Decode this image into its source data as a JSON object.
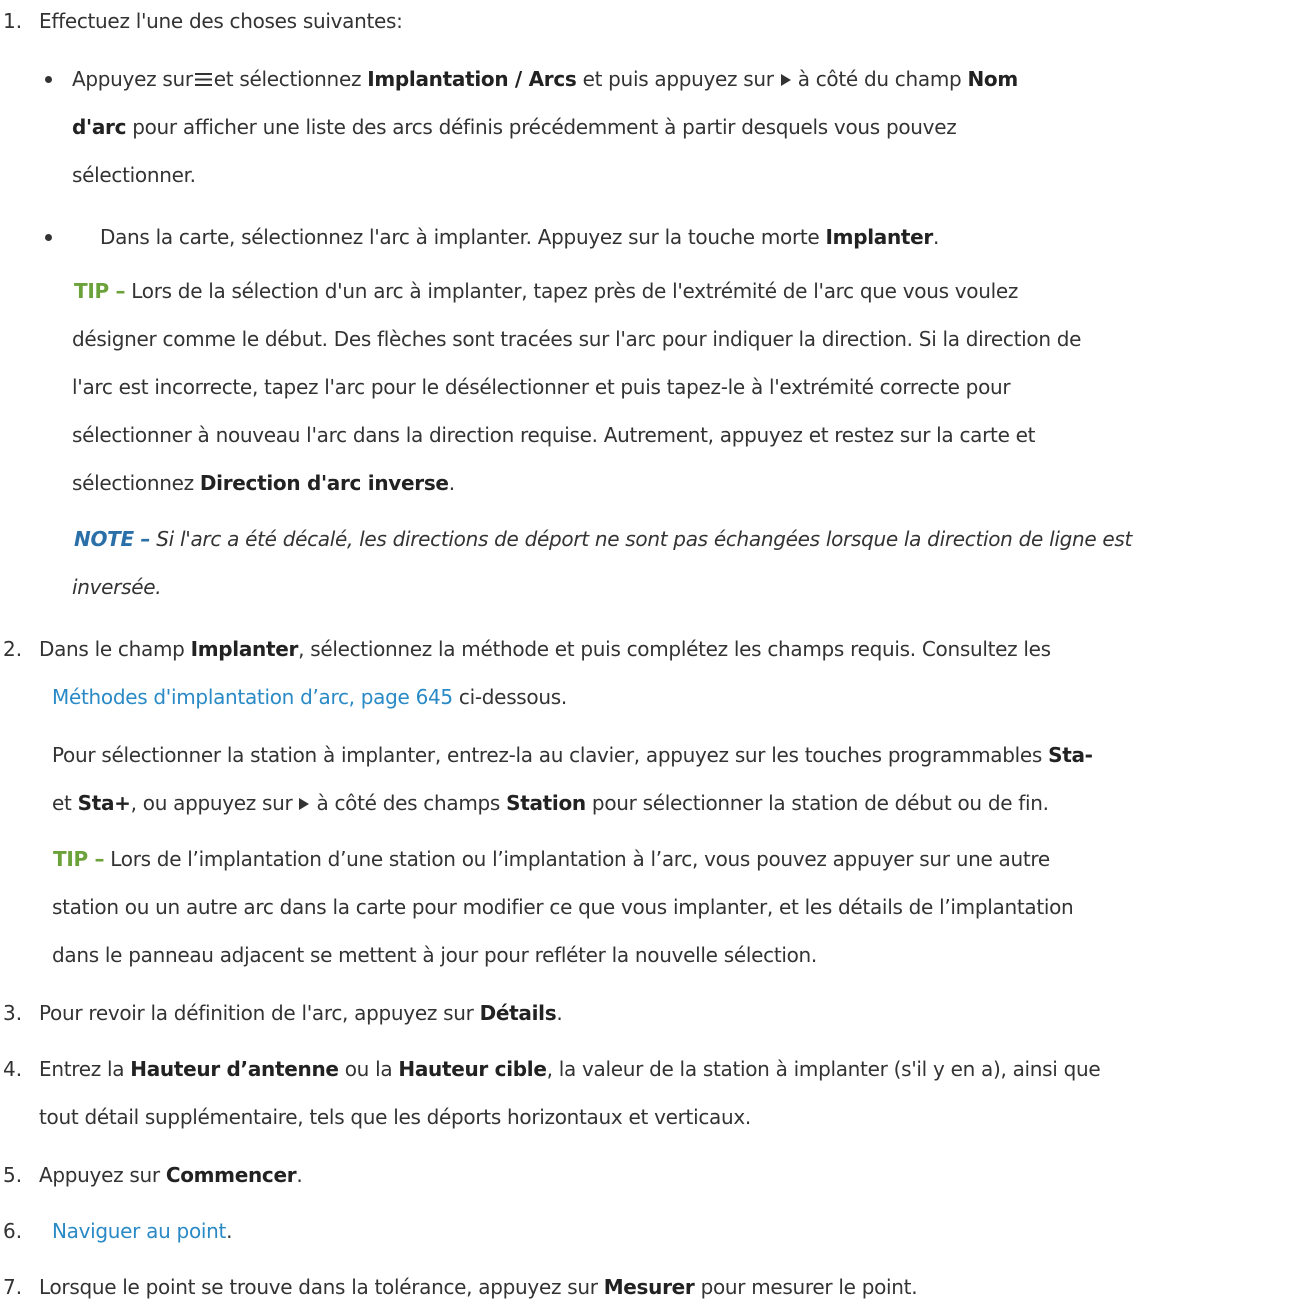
{
  "steps": {
    "s1_num": "1.",
    "s1_text": "Effectuez l'une des choses suivantes:",
    "b1_t1": "Appuyez sur",
    "b1_t2": "et sélectionnez",
    "b1_b1": "Implantation / Arcs",
    "b1_t3": "et puis appuyez sur",
    "b1_t4": "à côté du champ",
    "b1_b2": "Nom",
    "b1_b3": "d'arc",
    "b1_t5": "pour afficher une liste des arcs définis précédemment à partir desquels vous pouvez",
    "b1_t6": "sélectionner.",
    "b2_t1": "Dans la carte, sélectionnez l'arc à implanter. Appuyez sur la touche morte",
    "b2_b1": "Implanter",
    "b2_t2": ".",
    "tip1_label": "TIP –",
    "tip1_l1": "Lors de la sélection d'un arc à implanter, tapez près de l'extrémité de l'arc que vous voulez",
    "tip1_l2": "désigner comme le début. Des flèches sont tracées sur l'arc pour indiquer la direction. Si la direction de",
    "tip1_l3": "l'arc est incorrecte, tapez l'arc pour le désélectionner et puis tapez-le à l'extrémité correcte pour",
    "tip1_l4": "sélectionner à nouveau l'arc dans la direction requise. Autrement, appuyez et restez sur la carte et",
    "tip1_l5a": "sélectionnez",
    "tip1_l5b": "Direction d'arc inverse",
    "tip1_l5c": ".",
    "note_label": "NOTE –",
    "note_l1": "Si l'arc a été décalé, les directions de déport ne sont pas échangées lorsque la direction de ligne est",
    "note_l2": "inversée.",
    "s2_num": "2.",
    "s2_t1": "Dans le champ",
    "s2_b1": "Implanter",
    "s2_t2": ", sélectionnez la méthode et puis complétez les champs requis. Consultez les",
    "s2_link": "Méthodes d'implantation d’arc, page 645",
    "s2_t3": "ci-dessous.",
    "p_l1": "Pour sélectionner la station à implanter, entrez-la au clavier, appuyez sur les touches programmables",
    "p_b1": "Sta-",
    "p_t2": "et",
    "p_b2": "Sta+",
    "p_t3": ", ou appuyez sur",
    "p_t4": "à côté des champs",
    "p_b3": "Station",
    "p_t5": "pour sélectionner la station de début ou de fin.",
    "tip2_label": "TIP –",
    "tip2_l1": "Lors de l’implantation d’une station ou l’implantation à l’arc, vous pouvez appuyer sur une autre",
    "tip2_l2": "station ou un autre arc dans la carte pour modifier ce que vous implanter, et les détails de l’implantation",
    "tip2_l3": "dans le panneau adjacent se mettent à jour pour refléter la nouvelle sélection.",
    "s3_num": "3.",
    "s3_t1": "Pour revoir la définition de l'arc, appuyez sur",
    "s3_b1": "Détails",
    "s3_t2": ".",
    "s4_num": "4.",
    "s4_t1": "Entrez la",
    "s4_b1": "Hauteur d’antenne",
    "s4_t2": "ou la",
    "s4_b2": "Hauteur cible",
    "s4_t3": ", la valeur de la station à implanter (s'il y en a), ainsi que",
    "s4_l2": "tout détail supplémentaire, tels que les déports horizontaux et verticaux.",
    "s5_num": "5.",
    "s5_t1": "Appuyez sur",
    "s5_b1": "Commencer",
    "s5_t2": ".",
    "s6_num": "6.",
    "s6_link": "Naviguer au point",
    "s6_t2": ".",
    "s7_num": "7.",
    "s7_t1": "Lorsque le point se trouve dans la tolérance, appuyez sur",
    "s7_b1": "Mesurer",
    "s7_t2": "pour mesurer le point."
  },
  "icons": {
    "menu": "menu-icon",
    "play": "play-triangle-icon"
  }
}
